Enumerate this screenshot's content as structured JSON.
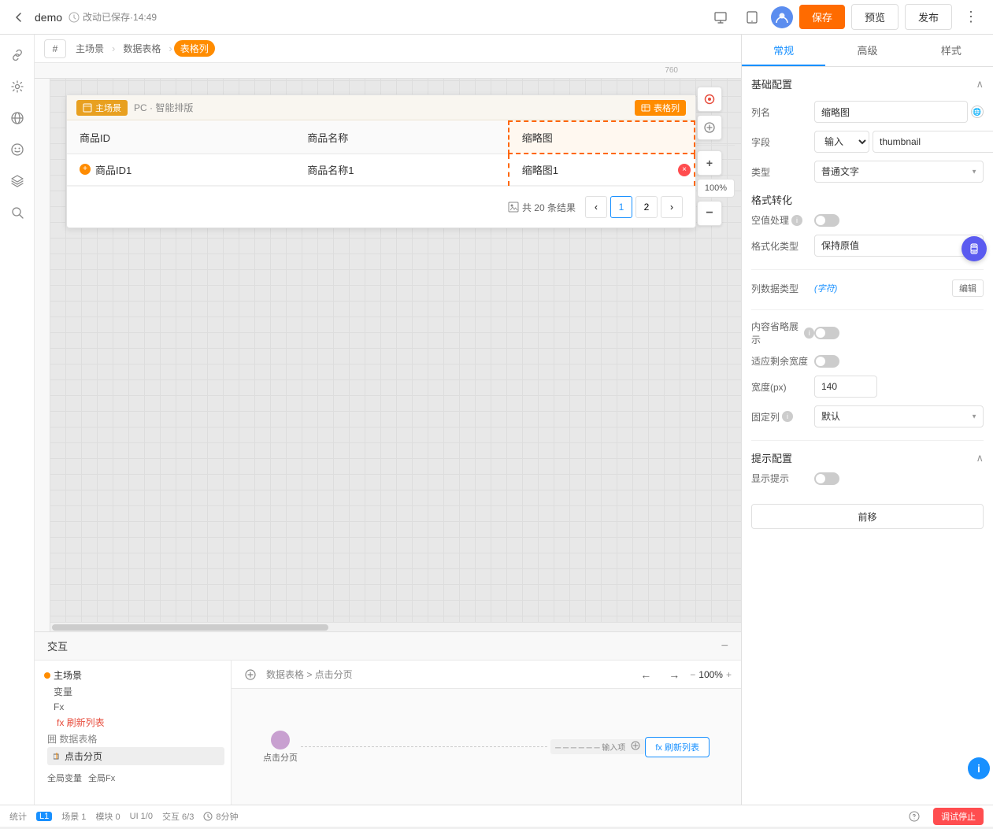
{
  "topbar": {
    "back_label": "←",
    "title": "demo",
    "save_status": "改动已保存·14:49",
    "save_btn": "保存",
    "preview_btn": "预览",
    "publish_btn": "发布",
    "more_label": "⋮"
  },
  "breadcrumb": {
    "hash": "#",
    "items": [
      "主场景",
      "数据表格",
      "表格列"
    ]
  },
  "canvas": {
    "zoom": "100%",
    "ruler_number": "760"
  },
  "scene": {
    "title_tag": "主场景",
    "subtitle": "PC · 智能排版",
    "table_tag": "表格列",
    "columns": [
      "商品ID",
      "商品名称",
      "缩略图"
    ],
    "rows": [
      {
        "id": "商品ID1",
        "name": "商品名称1",
        "thumb": "缩略图1"
      }
    ],
    "pagination": {
      "total": "共 20 条结果",
      "pages": [
        "1",
        "2"
      ]
    }
  },
  "interaction": {
    "title": "交互",
    "tree": {
      "main_scene": "主场景",
      "variable": "变量",
      "fx": "Fx",
      "refresh_method": "fx 刷新列表",
      "data_table": "囲 数据表格",
      "click_page": "点击分页",
      "global_var": "全局变量",
      "global_fx": "全局Fx"
    },
    "flow": {
      "breadcrumb": "数据表格 > 点击分页",
      "trigger": "点击分页",
      "arrow1": "",
      "input_node": "输入项",
      "arrow2": "",
      "action": "fx 刷新列表"
    }
  },
  "properties": {
    "tabs": [
      "常规",
      "高级",
      "样式"
    ],
    "active_tab": "常规",
    "sections": {
      "basic_config": {
        "title": "基础配置",
        "column_name_label": "列名",
        "column_name_value": "缩略图",
        "field_label": "字段",
        "field_type": "输入",
        "field_value": "thumbnail",
        "type_label": "类型",
        "type_value": "普通文字",
        "format_label": "格式转化",
        "null_handle_label": "空值处理",
        "format_type_label": "格式化类型",
        "format_type_value": "保持原值"
      },
      "column_data_type": {
        "label": "列数据类型",
        "type_value": "(字符)",
        "edit_btn": "编辑"
      },
      "display": {
        "content_abbr_label": "内容省略展示",
        "adapt_width_label": "适应剩余宽度",
        "width_label": "宽度(px)",
        "width_value": "140",
        "fixed_col_label": "固定列",
        "fixed_col_value": "默认"
      },
      "hint": {
        "title": "提示配置",
        "show_hint_label": "显示提示"
      }
    },
    "front_btn": "前移"
  },
  "statusbar": {
    "stat": "统计",
    "l1": "L1",
    "scene_count": "场景 1",
    "module_count": "模块 0",
    "ui_count": "UI 1/0",
    "interaction_count": "交互 6/3",
    "time": "8分钟",
    "debug_btn": "调试停止"
  }
}
